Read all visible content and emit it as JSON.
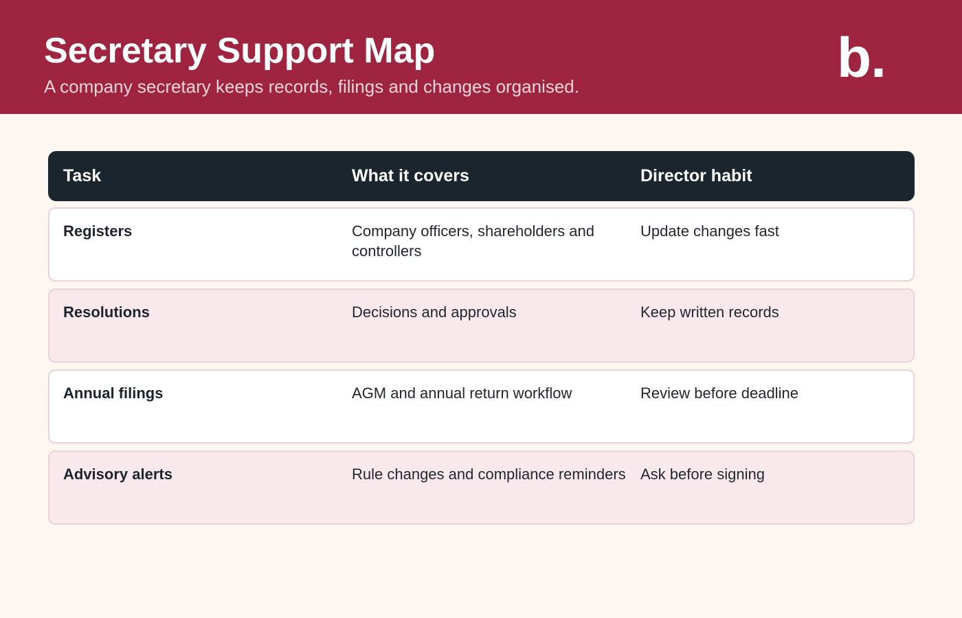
{
  "header": {
    "title": "Secretary Support Map",
    "subtitle": "A company secretary keeps records, filings and changes organised.",
    "logo_text": "b.",
    "background_color": "#9e2440"
  },
  "table": {
    "columns": [
      "Task",
      "What it covers",
      "Director habit"
    ],
    "header_color": "#1a252e",
    "rows": [
      {
        "task": "Registers",
        "covers": "Company officers, shareholders and controllers",
        "habit": "Update changes fast"
      },
      {
        "task": "Resolutions",
        "covers": "Decisions and approvals",
        "habit": "Keep written records"
      },
      {
        "task": "Annual filings",
        "covers": "AGM and annual return workflow",
        "habit": "Review before deadline"
      },
      {
        "task": "Advisory alerts",
        "covers": "Rule changes and compliance reminders",
        "habit": "Ask before signing"
      }
    ]
  }
}
